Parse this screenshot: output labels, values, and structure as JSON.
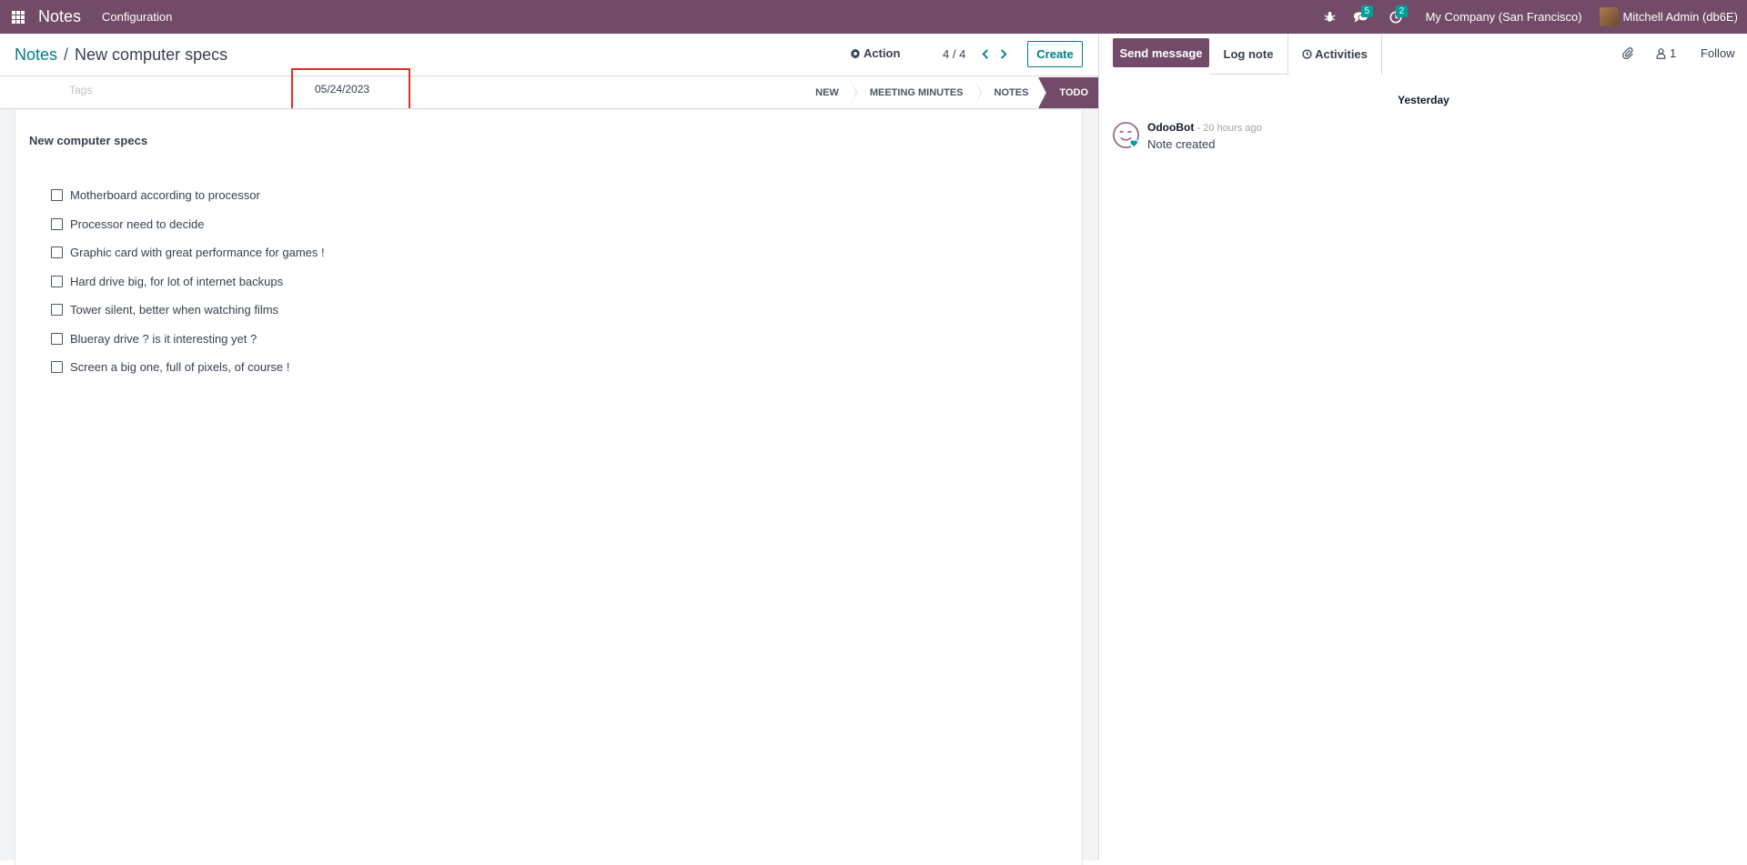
{
  "navbar": {
    "app_name": "Notes",
    "menu": [
      "Configuration"
    ],
    "messages_count": "5",
    "activities_count": "2",
    "company": "My Company (San Francisco)",
    "user": "Mitchell Admin (db6E)"
  },
  "breadcrumb": {
    "parent": "Notes",
    "separator": "/",
    "current": "New computer specs"
  },
  "control_panel": {
    "action_label": "Action",
    "pager_value": "4 / 4",
    "create_label": "Create"
  },
  "fields": {
    "tags_placeholder": "Tags",
    "date": "05/24/2023"
  },
  "stages": [
    "NEW",
    "MEETING MINUTES",
    "NOTES",
    "TODO"
  ],
  "active_stage": "TODO",
  "note": {
    "title": "New computer specs",
    "checklist": [
      "Motherboard according to processor",
      "Processor need to decide",
      "Graphic card with great performance for games !",
      "Hard drive big, for lot of internet backups",
      "Tower silent, better when watching films",
      "Blueray drive ? is it interesting yet ?",
      "Screen a big one, full of pixels, of course !"
    ]
  },
  "chatter": {
    "send_message": "Send message",
    "log_note": "Log note",
    "activities": "Activities",
    "followers_count": "1",
    "follow_label": "Follow",
    "day_separator": "Yesterday",
    "message": {
      "author": "OdooBot",
      "date": "- 20 hours ago",
      "body": "Note created"
    }
  },
  "colors": {
    "brand": "#714b67",
    "accent": "#017e84",
    "badge": "#00a09d",
    "highlight": "#e52a2a"
  }
}
